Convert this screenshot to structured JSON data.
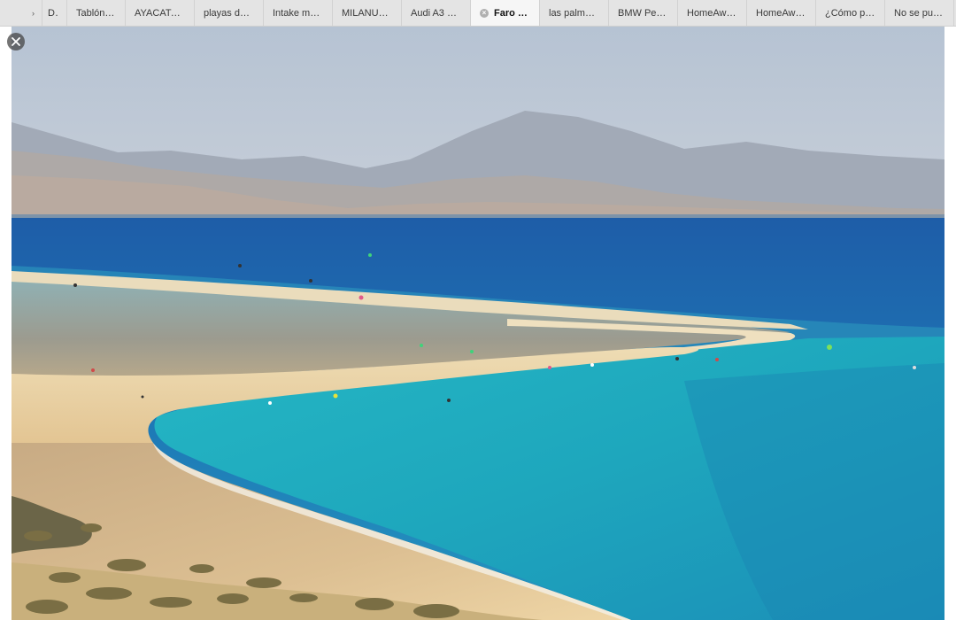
{
  "tabs": [
    {
      "label": "Det",
      "active": false
    },
    {
      "label": "Tablón de...",
      "active": false
    },
    {
      "label": "AYACATA'...",
      "active": false
    },
    {
      "label": "playas de f...",
      "active": false
    },
    {
      "label": "Intake man...",
      "active": false
    },
    {
      "label": "MILANUN...",
      "active": false
    },
    {
      "label": "Audi A3 S l...",
      "active": false
    },
    {
      "label": "Faro de...",
      "active": true
    },
    {
      "label": "las palmas...",
      "active": false
    },
    {
      "label": "BMW Pers...",
      "active": false
    },
    {
      "label": "HomeAwa...",
      "active": false
    },
    {
      "label": "HomeAwa...",
      "active": false
    },
    {
      "label": "¿Cómo pu...",
      "active": false
    },
    {
      "label": "No se pue...",
      "active": false
    }
  ],
  "icons": {
    "tab_overflow": "chevron-left-icon",
    "tab_close": "close-icon",
    "viewer_close": "close-icon"
  },
  "colors": {
    "sky": "#b9c5d3",
    "deep_sea": "#1f5fa6",
    "turquoise": "#2fb3c2",
    "sand": "#e9d2a4",
    "mountains": "#9aa3b1"
  }
}
